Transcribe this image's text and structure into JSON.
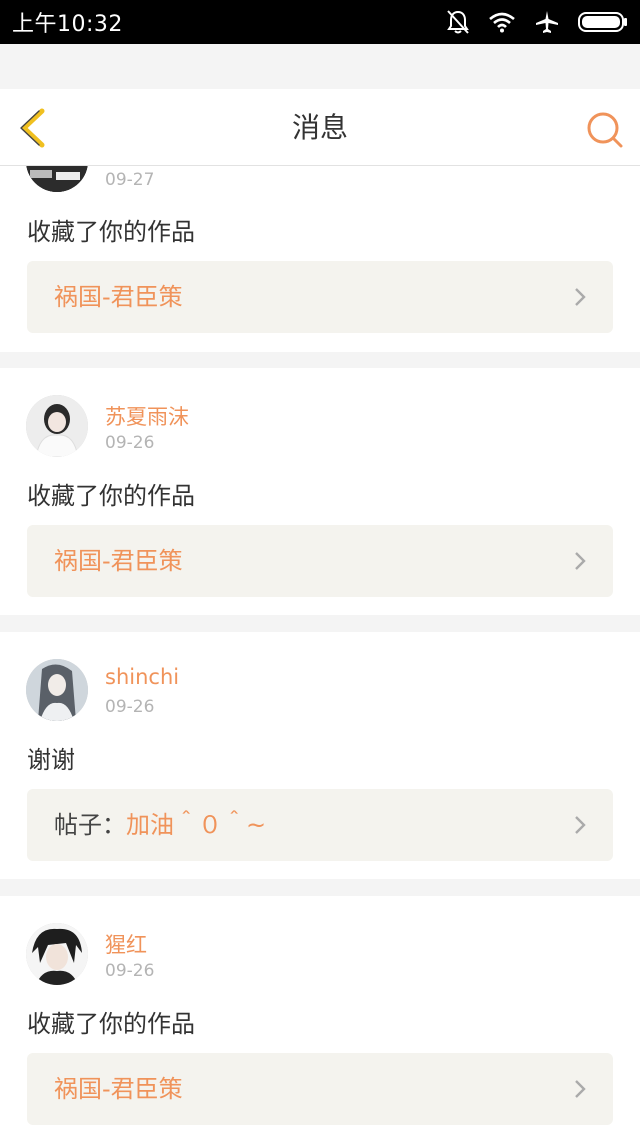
{
  "statusbar": {
    "time": "上午10:32"
  },
  "header": {
    "title": "消息"
  },
  "messages": [
    {
      "date": "09-27",
      "action": "收藏了你的作品",
      "ref": "祸国-君臣策"
    },
    {
      "user": "苏夏雨沫",
      "date": "09-26",
      "action": "收藏了你的作品",
      "ref": "祸国-君臣策"
    },
    {
      "user": "shinchi",
      "date": "09-26",
      "action": "谢谢",
      "ref_prefix": "帖子：",
      "ref": "加油＾０＾~"
    },
    {
      "user": "猩红",
      "date": "09-26",
      "action": "收藏了你的作品",
      "ref": "祸国-君臣策"
    }
  ],
  "colors": {
    "accent": "#f0935a",
    "back_arrow": "#f0c020",
    "bg": "#f4f4f4"
  }
}
